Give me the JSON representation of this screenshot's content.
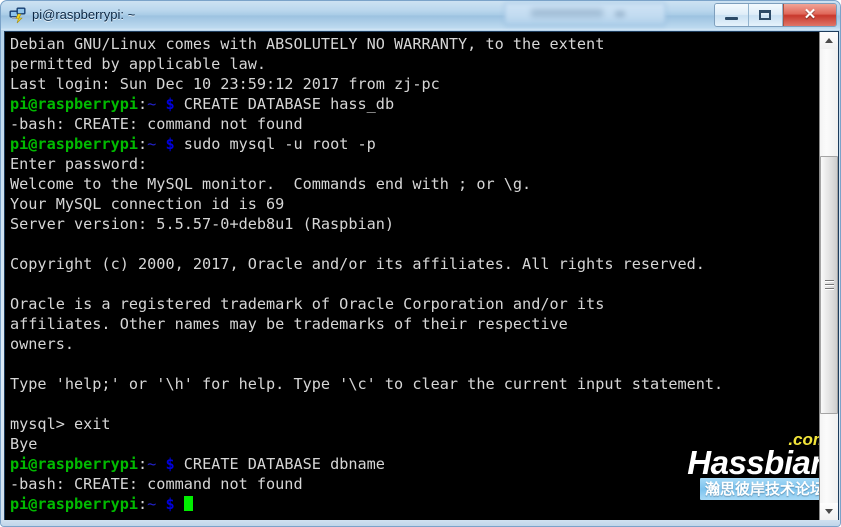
{
  "window": {
    "title": "pi@raspberrypi: ~",
    "icon": "putty-icon",
    "minimize_label": "",
    "maximize_label": "",
    "close_label": "✕"
  },
  "terminal": {
    "lines": [
      {
        "segments": [
          {
            "text": "Debian GNU/Linux comes with ABSOLUTELY NO WARRANTY, to the extent",
            "color": "white"
          }
        ]
      },
      {
        "segments": [
          {
            "text": "permitted by applicable law.",
            "color": "white"
          }
        ]
      },
      {
        "segments": [
          {
            "text": "Last login: Sun Dec 10 23:59:12 2017 from zj-pc",
            "color": "white"
          }
        ]
      },
      {
        "segments": [
          {
            "text": "pi@raspberrypi",
            "color": "green"
          },
          {
            "text": ":",
            "color": "white"
          },
          {
            "text": "~",
            "color": "cyan"
          },
          {
            "text": " ",
            "color": "white"
          },
          {
            "text": "$",
            "color": "blue"
          },
          {
            "text": " CREATE DATABASE hass_db",
            "color": "white"
          }
        ]
      },
      {
        "segments": [
          {
            "text": "-bash: CREATE: command not found",
            "color": "white"
          }
        ]
      },
      {
        "segments": [
          {
            "text": "pi@raspberrypi",
            "color": "green"
          },
          {
            "text": ":",
            "color": "white"
          },
          {
            "text": "~",
            "color": "cyan"
          },
          {
            "text": " ",
            "color": "white"
          },
          {
            "text": "$",
            "color": "blue"
          },
          {
            "text": " sudo mysql -u root -p",
            "color": "white"
          }
        ]
      },
      {
        "segments": [
          {
            "text": "Enter password:",
            "color": "white"
          }
        ]
      },
      {
        "segments": [
          {
            "text": "Welcome to the MySQL monitor.  Commands end with ; or \\g.",
            "color": "white"
          }
        ]
      },
      {
        "segments": [
          {
            "text": "Your MySQL connection id is 69",
            "color": "white"
          }
        ]
      },
      {
        "segments": [
          {
            "text": "Server version: 5.5.57-0+deb8u1 (Raspbian)",
            "color": "white"
          }
        ]
      },
      {
        "segments": [
          {
            "text": "",
            "color": "white"
          }
        ]
      },
      {
        "segments": [
          {
            "text": "Copyright (c) 2000, 2017, Oracle and/or its affiliates. All rights reserved.",
            "color": "white"
          }
        ]
      },
      {
        "segments": [
          {
            "text": "",
            "color": "white"
          }
        ]
      },
      {
        "segments": [
          {
            "text": "Oracle is a registered trademark of Oracle Corporation and/or its",
            "color": "white"
          }
        ]
      },
      {
        "segments": [
          {
            "text": "affiliates. Other names may be trademarks of their respective",
            "color": "white"
          }
        ]
      },
      {
        "segments": [
          {
            "text": "owners.",
            "color": "white"
          }
        ]
      },
      {
        "segments": [
          {
            "text": "",
            "color": "white"
          }
        ]
      },
      {
        "segments": [
          {
            "text": "Type 'help;' or '\\h' for help. Type '\\c' to clear the current input statement.",
            "color": "white"
          }
        ]
      },
      {
        "segments": [
          {
            "text": "",
            "color": "white"
          }
        ]
      },
      {
        "segments": [
          {
            "text": "mysql> exit",
            "color": "white"
          }
        ]
      },
      {
        "segments": [
          {
            "text": "Bye",
            "color": "white"
          }
        ]
      },
      {
        "segments": [
          {
            "text": "pi@raspberrypi",
            "color": "green"
          },
          {
            "text": ":",
            "color": "white"
          },
          {
            "text": "~",
            "color": "cyan"
          },
          {
            "text": " ",
            "color": "white"
          },
          {
            "text": "$",
            "color": "blue"
          },
          {
            "text": " CREATE DATABASE dbname",
            "color": "white"
          }
        ]
      },
      {
        "segments": [
          {
            "text": "-bash: CREATE: command not found",
            "color": "white"
          }
        ]
      },
      {
        "segments": [
          {
            "text": "pi@raspberrypi",
            "color": "green"
          },
          {
            "text": ":",
            "color": "white"
          },
          {
            "text": "~",
            "color": "cyan"
          },
          {
            "text": " ",
            "color": "white"
          },
          {
            "text": "$",
            "color": "blue"
          },
          {
            "text": " ",
            "color": "white"
          },
          {
            "text": "",
            "color": "cursor"
          }
        ]
      }
    ],
    "colors": {
      "background": "#000000",
      "foreground": "#bfbfbf",
      "green": "#00bb00",
      "blue": "#0000dd",
      "cursor": "#00ee00"
    }
  },
  "watermark": {
    "brand": "Hassbian",
    "tld": ".com",
    "chinese": "瀚思彼岸技术论坛",
    "brand_color": "#ffffff",
    "tld_color": "#f2e53a",
    "badge_color": "#7cc3ee"
  },
  "scrollbar": {
    "up_arrow": "scroll-up",
    "down_arrow": "scroll-down"
  }
}
